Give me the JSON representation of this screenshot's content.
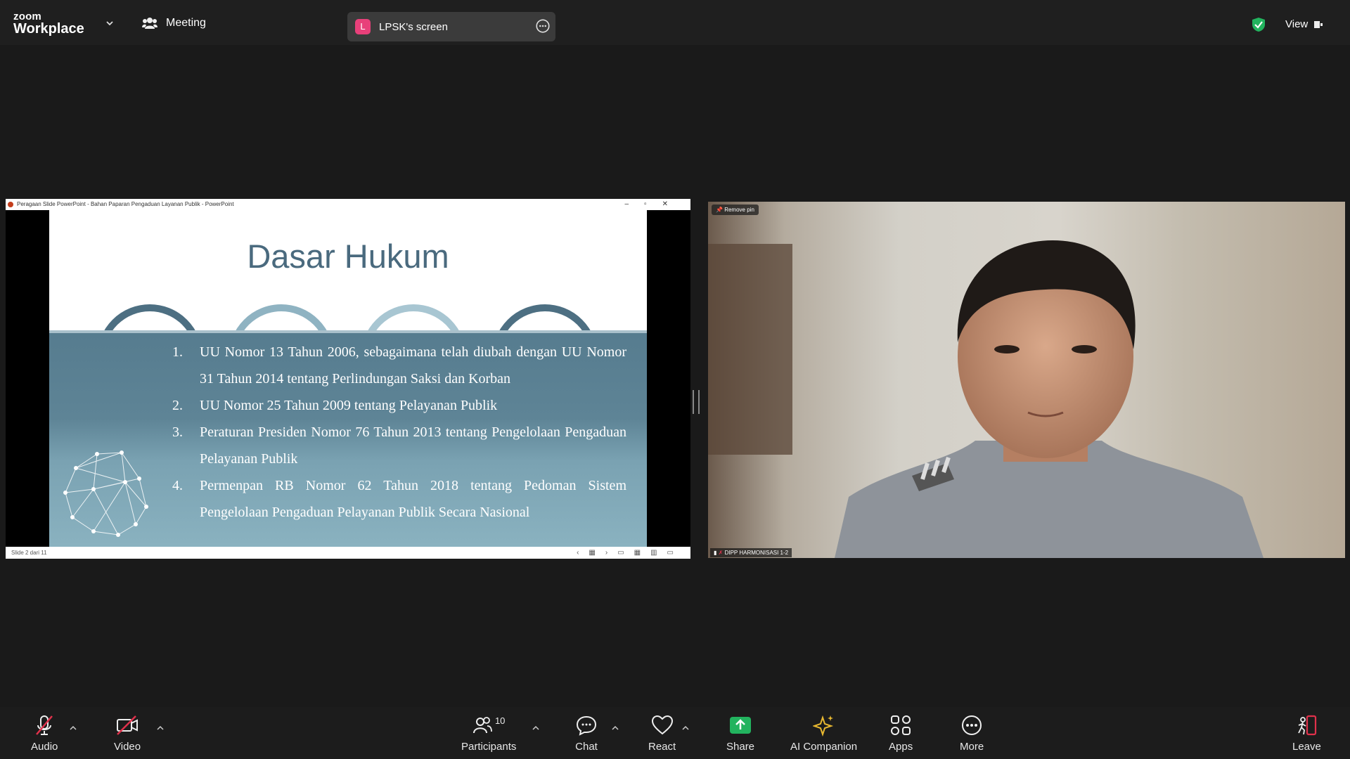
{
  "topbar": {
    "logo_small": "zoom",
    "logo_big": "Workplace",
    "meeting_label": "Meeting",
    "screen_badge": "L",
    "screen_name": "LPSK's screen",
    "view_label": "View"
  },
  "powerpoint": {
    "window_title": "Peragaan Slide PowerPoint  -  Bahan Paparan Pengaduan Layanan Publik - PowerPoint",
    "status_left": "Slide 2 dari 11"
  },
  "slide": {
    "title": "Dasar Hukum",
    "items": [
      {
        "num": "1.",
        "text": "UU Nomor 13 Tahun 2006, sebagaimana telah diubah dengan UU Nomor 31 Tahun 2014 tentang Perlindungan Saksi dan Korban"
      },
      {
        "num": "2.",
        "text": "UU Nomor 25 Tahun 2009 tentang Pelayanan Publik"
      },
      {
        "num": "3.",
        "text": "Peraturan Presiden Nomor 76 Tahun 2013 tentang Pengelolaan Pengaduan Pelayanan Publik"
      },
      {
        "num": "4.",
        "text": "Permenpan RB Nomor 62 Tahun 2018 tentang Pedoman Sistem Pengelolaan Pengaduan Pelayanan Publik Secara Nasional"
      }
    ]
  },
  "video": {
    "remove_pin_label": "Remove pin",
    "participant_name": "DIPP HARMONISASI 1-2"
  },
  "toolbar": {
    "audio": "Audio",
    "video": "Video",
    "participants": "Participants",
    "participants_count": "10",
    "chat": "Chat",
    "react": "React",
    "share": "Share",
    "ai_companion": "AI Companion",
    "apps": "Apps",
    "more": "More",
    "leave": "Leave"
  },
  "colors": {
    "share_green": "#22b35e",
    "ai_yellow": "#e8b830",
    "muted_red": "#e0314b",
    "slide_title": "#4a6a7e",
    "slide_band": "#5e8496"
  }
}
